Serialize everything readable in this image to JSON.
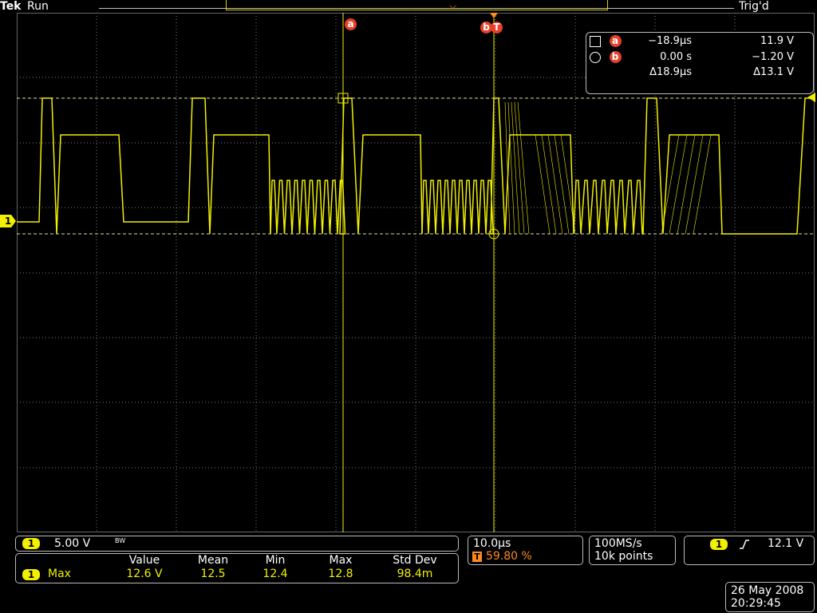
{
  "top": {
    "brand": "Tek",
    "run_state": "Run",
    "trigger_state": "Trig'd"
  },
  "cursors": {
    "a_label": "a",
    "b_label": "b",
    "trigger_marker": "T",
    "channel_marker": "1"
  },
  "readout": {
    "a": {
      "label": "a",
      "time": "−18.9µs",
      "volt": "11.9 V"
    },
    "b": {
      "label": "b",
      "time": "0.00 s",
      "volt": "−1.20 V"
    },
    "delta": {
      "time": "Δ18.9µs",
      "volt": "Δ13.1 V"
    }
  },
  "channel_panel": {
    "channel": "1",
    "scale": "5.00 V",
    "bw_marker": "BW"
  },
  "measurements": {
    "headers": [
      "Value",
      "Mean",
      "Min",
      "Max",
      "Std Dev"
    ],
    "rows": [
      {
        "channel": "1",
        "name": "Max",
        "value": "12.6 V",
        "mean": "12.5",
        "min": "12.4",
        "max": "12.8",
        "std_dev": "98.4m"
      }
    ]
  },
  "horizontal": {
    "timebase": "10.0µs",
    "trigger_pos": "59.80 %"
  },
  "acquisition": {
    "sample_rate": "100MS/s",
    "record_length": "10k points"
  },
  "trigger": {
    "channel": "1",
    "slope_icon": "rising-edge-icon",
    "level": "12.1 V"
  },
  "datetime": {
    "date": "26 May 2008",
    "time": "20:29:45"
  },
  "colors": {
    "trace": "#f2ef00",
    "cursor_badge": "#e8402a",
    "trigger_pos": "#ff8a1e"
  }
}
